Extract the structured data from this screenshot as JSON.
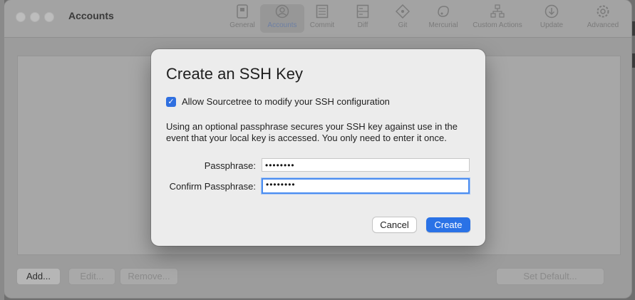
{
  "window": {
    "title": "Accounts"
  },
  "toolbar": {
    "items": [
      {
        "label": "General",
        "icon": "general-icon"
      },
      {
        "label": "Accounts",
        "icon": "person-icon",
        "active": true
      },
      {
        "label": "Commit",
        "icon": "commit-icon"
      },
      {
        "label": "Diff",
        "icon": "diff-icon"
      },
      {
        "label": "Git",
        "icon": "git-icon"
      },
      {
        "label": "Mercurial",
        "icon": "mercurial-icon"
      },
      {
        "label": "Custom Actions",
        "icon": "custom-actions-icon"
      },
      {
        "label": "Update",
        "icon": "update-icon"
      },
      {
        "label": "Advanced",
        "icon": "gear-icon"
      }
    ]
  },
  "accounts_panel": {
    "add_label": "Add...",
    "edit_label": "Edit...",
    "remove_label": "Remove...",
    "set_default_label": "Set Default..."
  },
  "dialog": {
    "title": "Create an SSH Key",
    "checkbox_label": "Allow Sourcetree to modify your SSH configuration",
    "checkbox_checked": true,
    "description": "Using an optional passphrase secures your SSH key against use in the event that your local key is accessed. You only need to enter it once.",
    "passphrase_label": "Passphrase:",
    "passphrase_value": "••••••••",
    "confirm_label": "Confirm Passphrase:",
    "confirm_value": "••••••••",
    "cancel_label": "Cancel",
    "create_label": "Create"
  },
  "colors": {
    "accent": "#2a72e6",
    "focus_ring": "#4b8df0",
    "active_tab_text": "#6d7fa3"
  }
}
